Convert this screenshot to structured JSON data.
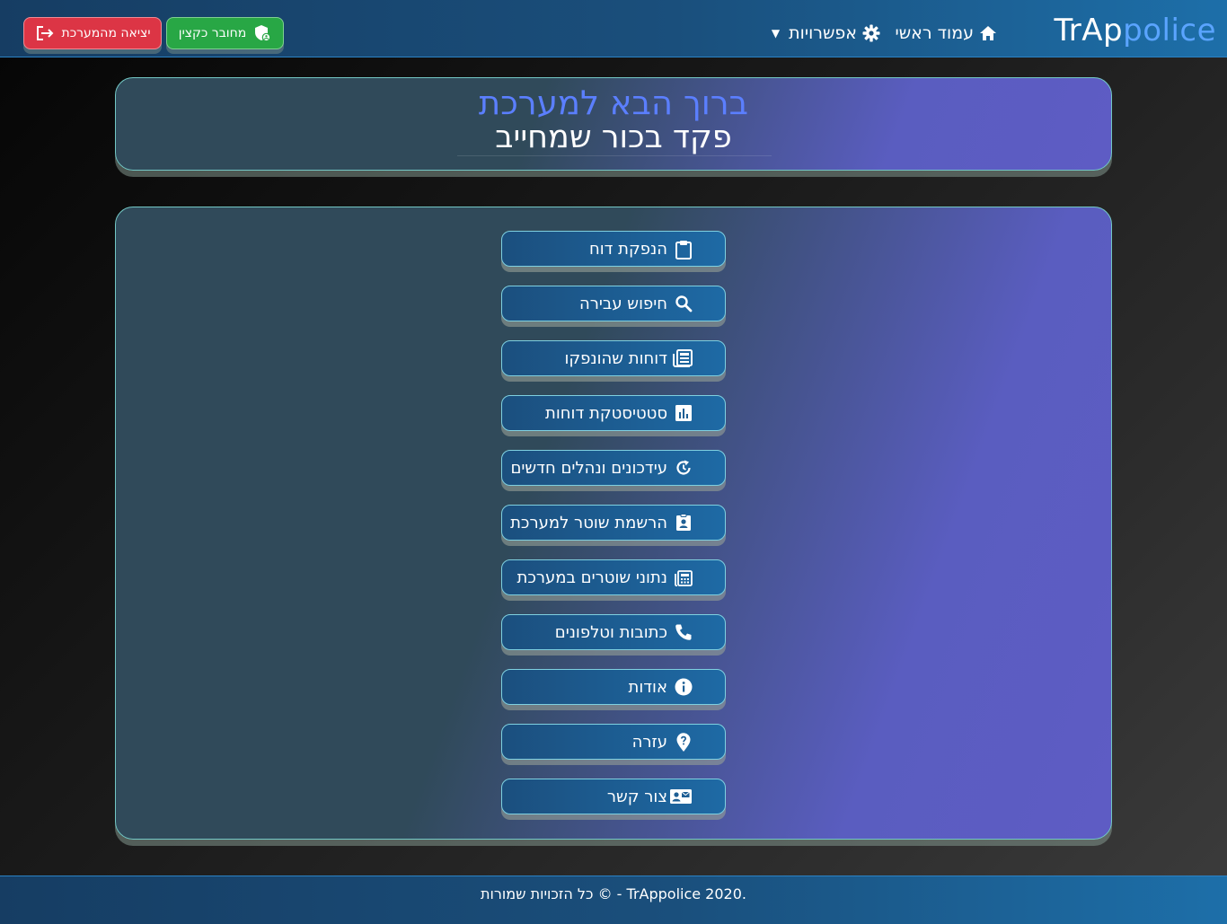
{
  "navbar": {
    "brand_part1": "TrAp",
    "brand_part2": "police",
    "home_label": "עמוד ראשי",
    "options_label": "אפשרויות",
    "connected_label": "מחובר כקצין",
    "logout_label": "יציאה מהמערכת"
  },
  "welcome": {
    "line1": "ברוך הבא למערכת",
    "line2": "פקד בכור שמחייב"
  },
  "menu": [
    {
      "label": "הנפקת דוח",
      "icon": "clipboard-icon"
    },
    {
      "label": "חיפוש עבירה",
      "icon": "search-icon"
    },
    {
      "label": "דוחות שהונפקו",
      "icon": "newspaper-icon"
    },
    {
      "label": "סטטיסטקת דוחות",
      "icon": "bar-chart-icon"
    },
    {
      "label": "עידכונים ונהלים חדשים",
      "icon": "refresh-icon"
    },
    {
      "label": "הרשמת שוטר למערכת",
      "icon": "id-badge-icon"
    },
    {
      "label": "נתוני שוטרים במערכת",
      "icon": "calculator-icon"
    },
    {
      "label": "כתובות וטלפונים",
      "icon": "phone-icon"
    },
    {
      "label": "אודות",
      "icon": "info-icon"
    },
    {
      "label": "עזרה",
      "icon": "help-pin-icon"
    },
    {
      "label": "צור קשר",
      "icon": "contact-card-icon"
    }
  ],
  "footer": {
    "text": "כל הזכויות שמורות © - TrAppolice 2020."
  },
  "colors": {
    "navbar": "#1a4f7c",
    "logout": "#dc3545",
    "connected": "#28a745",
    "title_accent": "#5b7fff"
  }
}
